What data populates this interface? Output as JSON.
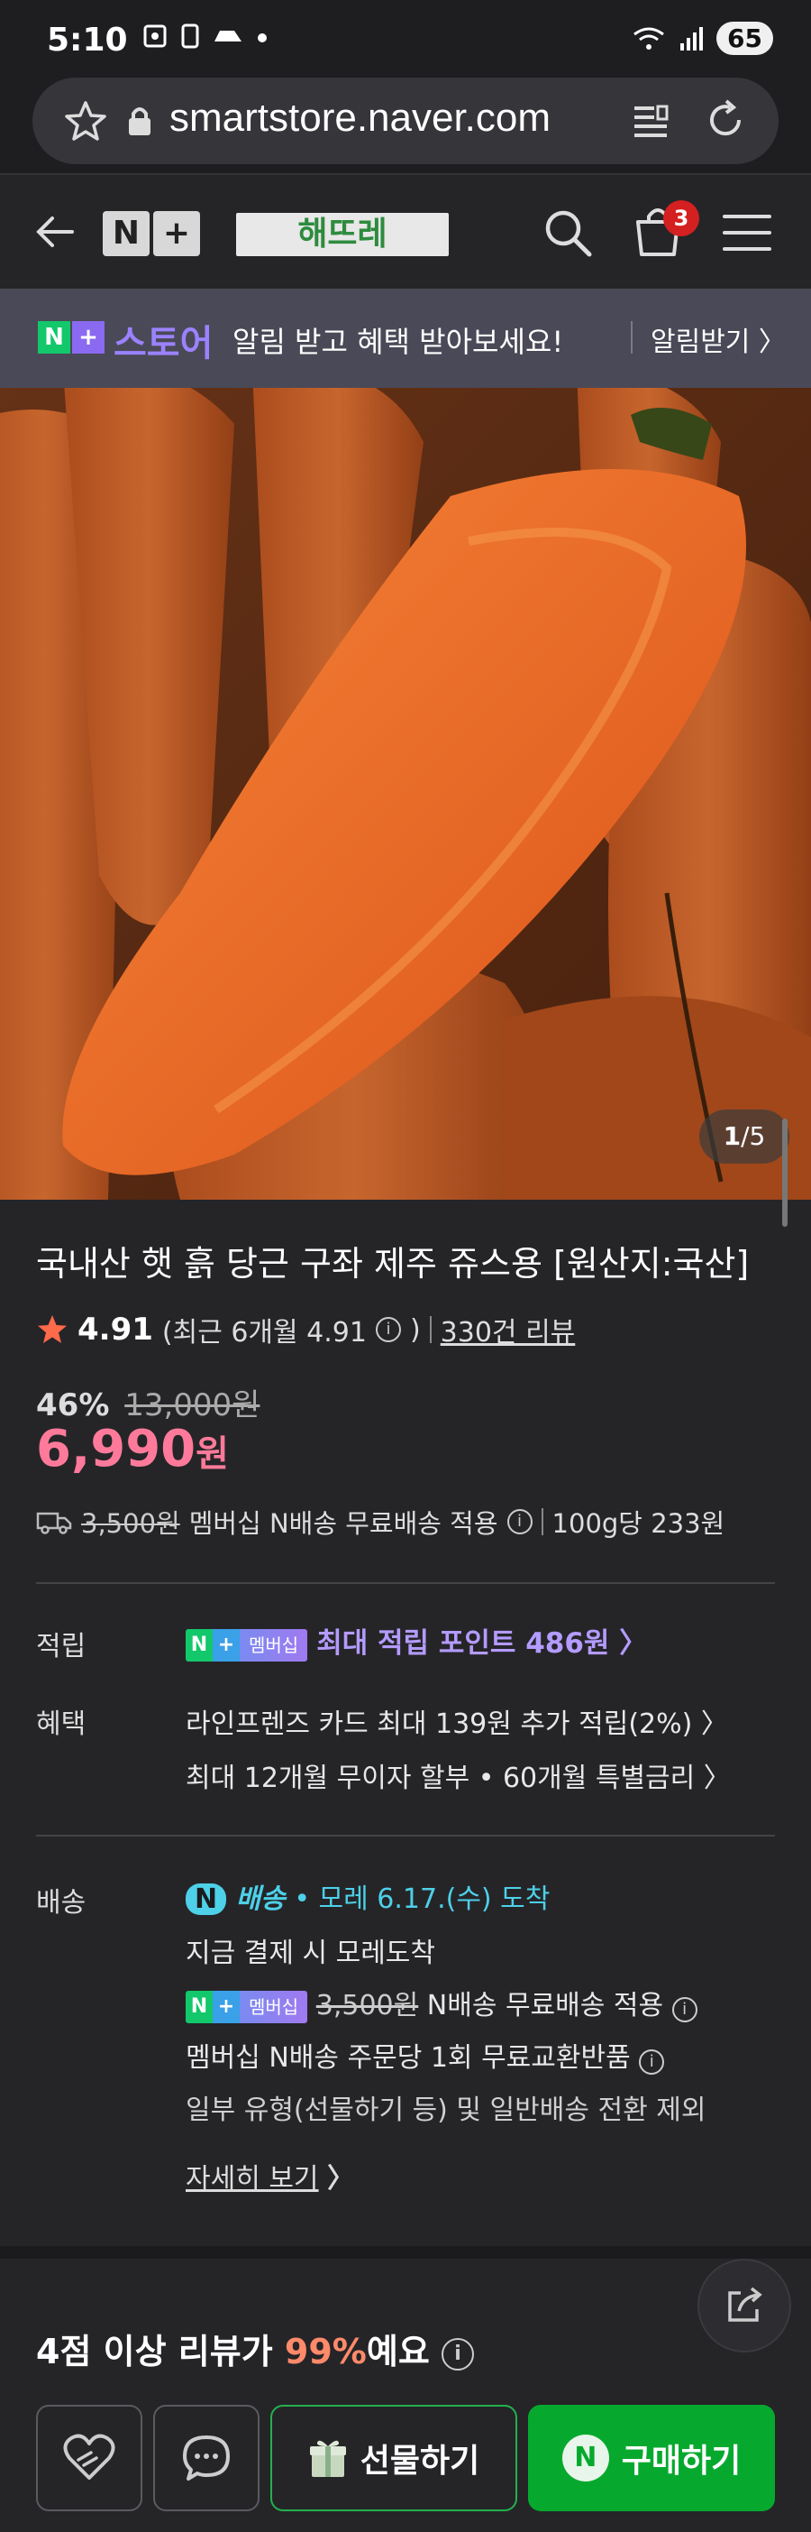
{
  "status_bar": {
    "time": "5:10",
    "battery": "65",
    "left_icons": [
      "screenshot-icon",
      "phone-icon",
      "delivery-icon",
      "dot-icon"
    ],
    "right_icons": [
      "wifi-icon",
      "signal-icon"
    ]
  },
  "browser": {
    "url": "smartstore.naver.com"
  },
  "header": {
    "nplus_left": "N",
    "nplus_right": "+",
    "store_logo": "해뜨레",
    "cart_count": "3"
  },
  "notify_banner": {
    "badge_n": "N",
    "badge_plus": "+",
    "store_label": "스토어",
    "message": "알림 받고 혜택 받아보세요!",
    "action": "알림받기 〉"
  },
  "gallery": {
    "current": "1",
    "total": "5",
    "counter_sep": "/"
  },
  "product": {
    "title": "국내산 햇 흙 당근 구좌 제주 쥬스용 [원산지:국산]",
    "rating": "4.91",
    "recent_rating": "(최근 6개월 4.91",
    "recent_rating_close": ")",
    "review_count": "330건 리뷰",
    "discount_pct": "46%",
    "original_price": "13,000원",
    "price": "6,990",
    "price_unit": "원",
    "ship_fee": "3,500원",
    "ship_text": "멤버십 N배송 무료배송 적용",
    "unit_price": "100g당 233원"
  },
  "points": {
    "label": "적립",
    "pill_text": "멤버십",
    "text": "최대 적립 포인트 486원 〉"
  },
  "benefits": {
    "label": "혜택",
    "line1": "라인프렌즈 카드 최대 139원 추가 적립(2%) 〉",
    "line2": "최대 12개월 무이자 할부 • 60개월 특별금리 〉"
  },
  "delivery": {
    "label": "배송",
    "tag_n": "N",
    "tag_text": "배송",
    "arrival": "• 모레 6.17.(수) 도착",
    "line2": "지금 결제 시 모레도착",
    "pill_text": "멤버십",
    "fee": "3,500원",
    "fee_text": "N배송 무료배송 적용",
    "line4": "멤버십 N배송 주문당 1회 무료교환반품",
    "line5": "일부 유형(선물하기 등) 및 일반배송 전환 제외",
    "more": "자세히 보기",
    "more_arrow": "〉"
  },
  "reviews": {
    "head_prefix": "4점 이상 리뷰가 ",
    "pct": "99%",
    "head_suffix": "예요"
  },
  "bottom_bar": {
    "gift_label": "선물하기",
    "buy_n": "N",
    "buy_label": "구매하기"
  },
  "colors": {
    "price": "#ff7a9a",
    "buy_button": "#06a92e",
    "point_text": "#b49bff",
    "delivery": "#4dd0e8"
  }
}
